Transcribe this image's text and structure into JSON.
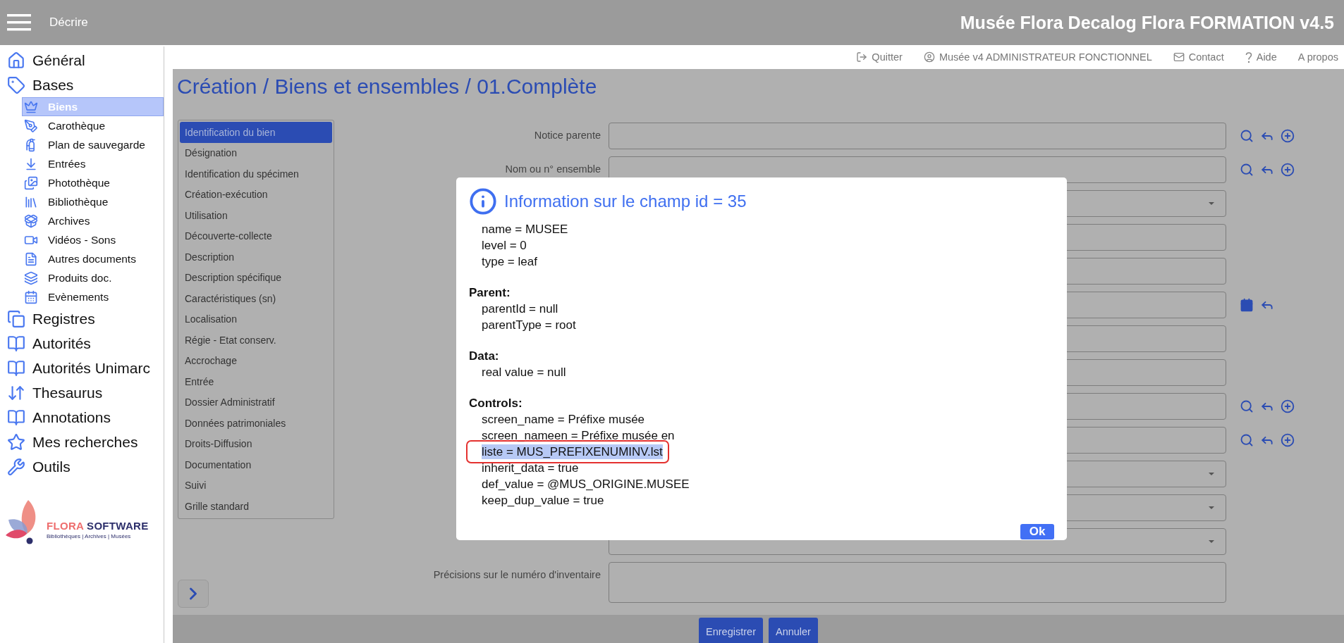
{
  "header": {
    "section": "Décrire",
    "app_title": "Musée Flora Decalog Flora FORMATION v4.5"
  },
  "top_links": [
    {
      "kind": "logout",
      "label": "Quitter"
    },
    {
      "kind": "user",
      "label": "Musée v4 ADMINISTRATEUR FONCTIONNEL"
    },
    {
      "kind": "contact",
      "label": "Contact"
    },
    {
      "kind": "help",
      "label": "Aide"
    },
    {
      "kind": "about",
      "label": "A propos"
    }
  ],
  "sidebar": {
    "items": [
      {
        "kind": "home",
        "label": "Général"
      },
      {
        "kind": "tag",
        "label": "Bases",
        "children": [
          {
            "kind": "knight",
            "label": "Biens",
            "selected": true
          },
          {
            "kind": "pen",
            "label": "Carothèque",
            "selected": false
          },
          {
            "kind": "extinguisher",
            "label": "Plan de sauvegarde",
            "selected": false
          },
          {
            "kind": "download",
            "label": "Entrées",
            "selected": false
          },
          {
            "kind": "images",
            "label": "Photothèque",
            "selected": false
          },
          {
            "kind": "library",
            "label": "Bibliothèque",
            "selected": false
          },
          {
            "kind": "box",
            "label": "Archives",
            "selected": false
          },
          {
            "kind": "video",
            "label": "Vidéos - Sons",
            "selected": false
          },
          {
            "kind": "document",
            "label": "Autres documents",
            "selected": false
          },
          {
            "kind": "stack",
            "label": "Produits doc.",
            "selected": false
          },
          {
            "kind": "calendar",
            "label": "Evènements",
            "selected": false
          }
        ]
      },
      {
        "kind": "copies",
        "label": "Registres"
      },
      {
        "kind": "book",
        "label": "Autorités"
      },
      {
        "kind": "book",
        "label": "Autorités Unimarc"
      },
      {
        "kind": "swap",
        "label": "Thesaurus"
      },
      {
        "kind": "book",
        "label": "Annotations"
      },
      {
        "kind": "star",
        "label": "Mes recherches"
      },
      {
        "kind": "wrench",
        "label": "Outils"
      }
    ],
    "logo": {
      "brand_first": "FLORA",
      "brand_second": "SOFTWARE",
      "tagline": "Bibliothèques | Archives | Musées"
    }
  },
  "page_title": "Création / Biens et ensembles / 01.Complète",
  "sections": [
    {
      "label": "Identification du bien",
      "selected": true
    },
    {
      "label": "Désignation",
      "selected": false
    },
    {
      "label": "Identification du spécimen",
      "selected": false
    },
    {
      "label": "Création-exécution",
      "selected": false
    },
    {
      "label": "Utilisation",
      "selected": false
    },
    {
      "label": "Découverte-collecte",
      "selected": false
    },
    {
      "label": "Description",
      "selected": false
    },
    {
      "label": "Description spécifique",
      "selected": false
    },
    {
      "label": "Caractéristiques (sn)",
      "selected": false
    },
    {
      "label": "Localisation",
      "selected": false
    },
    {
      "label": "Régie - Etat conserv.",
      "selected": false
    },
    {
      "label": "Accrochage",
      "selected": false
    },
    {
      "label": "Entrée",
      "selected": false
    },
    {
      "label": "Dossier Administratif",
      "selected": false
    },
    {
      "label": "Données patrimoniales",
      "selected": false
    },
    {
      "label": "Droits-Diffusion",
      "selected": false
    },
    {
      "label": "Documentation",
      "selected": false
    },
    {
      "label": "Suivi",
      "selected": false
    },
    {
      "label": "Grille standard",
      "selected": false
    }
  ],
  "form_rows": [
    {
      "kind": "lookup",
      "label": "Notice parente"
    },
    {
      "kind": "lookup",
      "label": "Nom ou n° ensemble"
    },
    {
      "kind": "select"
    },
    {
      "kind": "text"
    },
    {
      "kind": "text"
    },
    {
      "kind": "date"
    },
    {
      "kind": "text"
    },
    {
      "kind": "text"
    },
    {
      "kind": "lookup"
    },
    {
      "kind": "lookup"
    },
    {
      "kind": "select"
    },
    {
      "kind": "select"
    },
    {
      "kind": "select"
    },
    {
      "kind": "textarea",
      "label": "Précisions sur le numéro d'inventaire"
    }
  ],
  "dialog": {
    "title": "Information sur le champ id = 35",
    "groups": [
      {
        "lines": [
          {
            "text": "name = MUSEE",
            "selected": false
          },
          {
            "text": "level = 0",
            "selected": false
          },
          {
            "text": "type = leaf",
            "selected": false
          }
        ]
      },
      {
        "heading": "Parent:",
        "lines": [
          {
            "text": "parentId = null",
            "selected": false
          },
          {
            "text": "parentType = root",
            "selected": false
          }
        ]
      },
      {
        "heading": "Data:",
        "lines": [
          {
            "text": "real value = null",
            "selected": false
          }
        ]
      },
      {
        "heading": "Controls:",
        "lines": [
          {
            "text": "screen_name = Préfixe musée",
            "selected": false
          },
          {
            "text": "screen_nameen = Préfixe musée en",
            "selected": false
          },
          {
            "text": "liste = MUS_PREFIXENUMINV.lst",
            "selected": true
          },
          {
            "text": "inherit_data = true",
            "selected": false
          },
          {
            "text": "def_value = @MUS_ORIGINE.MUSEE",
            "selected": false
          },
          {
            "text": "keep_dup_value = true",
            "selected": false
          }
        ]
      }
    ],
    "button": "Ok"
  },
  "footer_buttons": [
    "Enregistrer",
    "Annuler"
  ]
}
